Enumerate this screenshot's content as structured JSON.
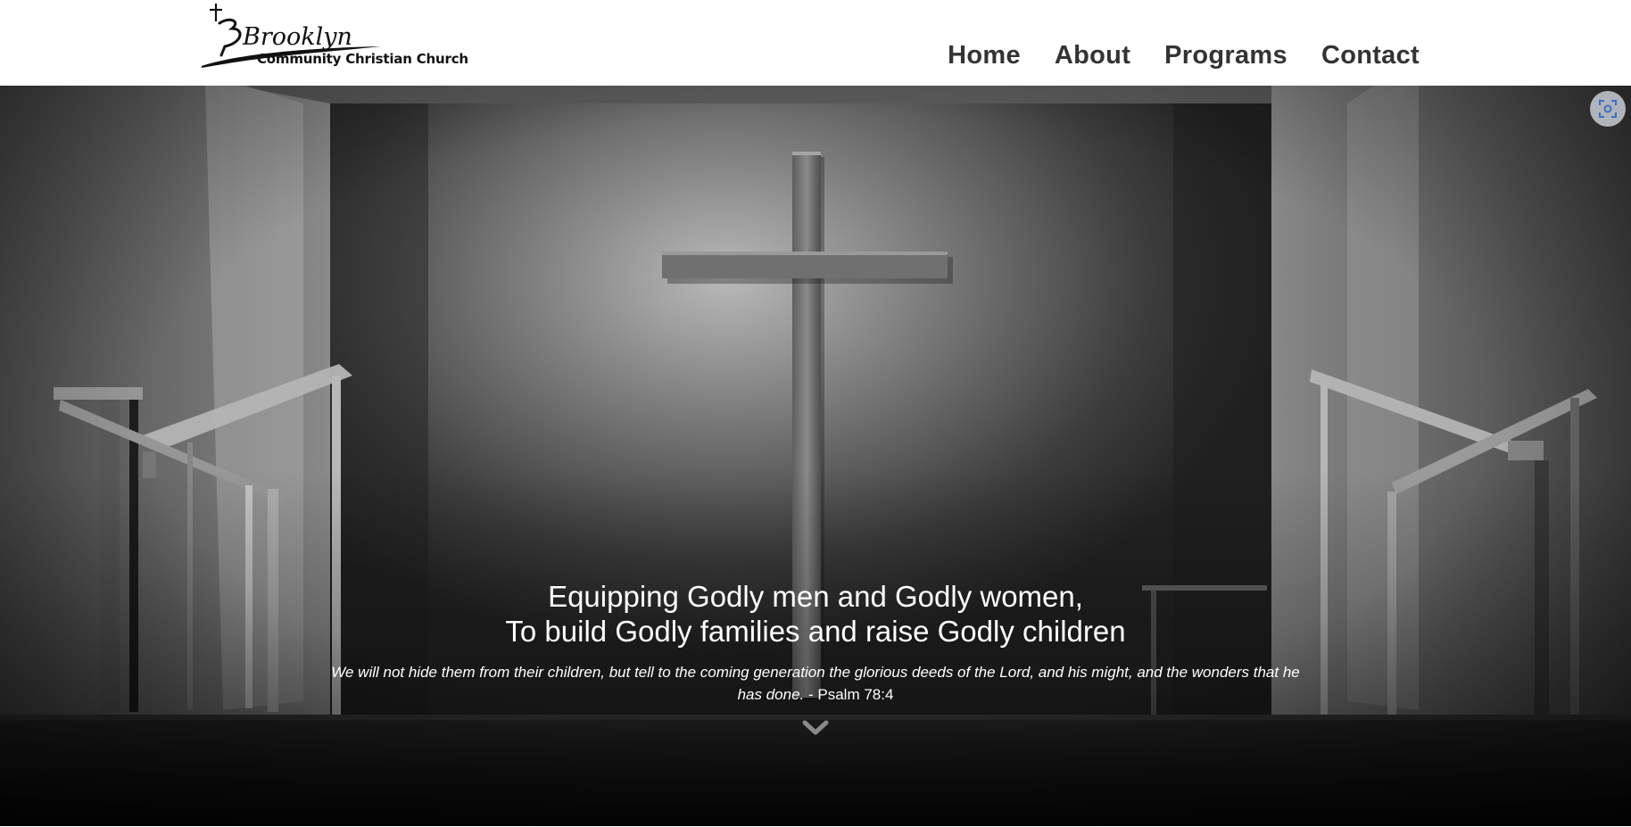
{
  "brand": {
    "logo_script": "Brooklyn",
    "logo_subtitle": "Community Christian Church"
  },
  "nav": {
    "items": [
      "Home",
      "About",
      "Programs",
      "Contact"
    ]
  },
  "hero": {
    "headline_line1": "Equipping Godly men and Godly women,",
    "headline_line2": "To build Godly families and raise Godly children",
    "verse_text": "We will not hide them from their children, but tell to the coming generation the glorious deeds of the Lord, and his might, and the wonders that he has done.",
    "verse_ref": " - Psalm 78:4"
  },
  "icons": {
    "scroll": "chevron-down-icon",
    "zoom": "focus-zoom-icon",
    "cross": "cross-icon"
  },
  "colors": {
    "nav_text": "#333333",
    "hero_text": "#ffffff",
    "zoom_icon": "#3b6fc9"
  }
}
